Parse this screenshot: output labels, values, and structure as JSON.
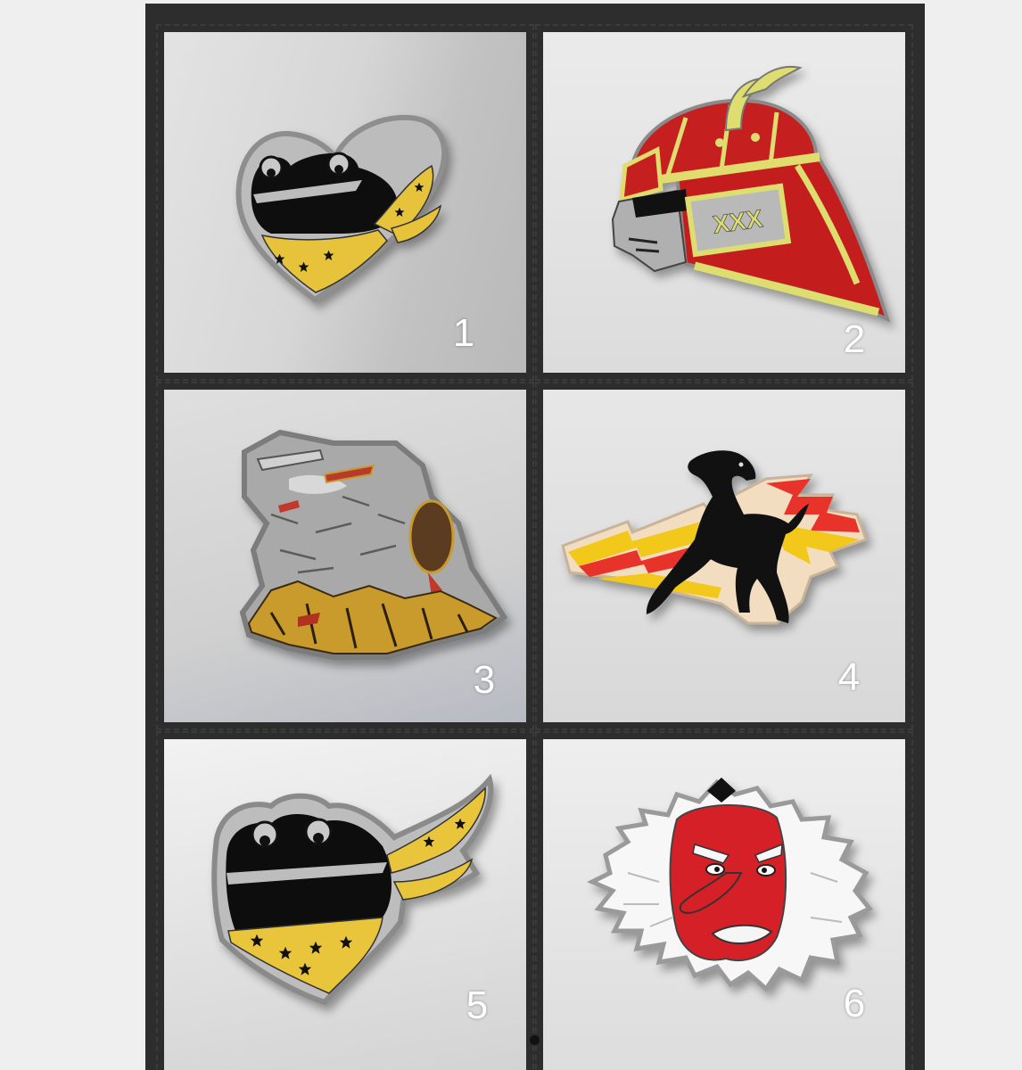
{
  "theme": {
    "page_background": "#efefef",
    "viewer_background": "#2d2d2d",
    "number_color": "#ffffff",
    "indicator_dot": "#111111",
    "patch_gray": "#bcbcbc",
    "patch_yellow": "#e6c33a",
    "patch_red": "#c61f1f",
    "patch_gold": "#dede70"
  },
  "patches": [
    {
      "number": "1"
    },
    {
      "number": "2",
      "embroidered_text": "XXX"
    },
    {
      "number": "3"
    },
    {
      "number": "4"
    },
    {
      "number": "5"
    },
    {
      "number": "6"
    }
  ]
}
